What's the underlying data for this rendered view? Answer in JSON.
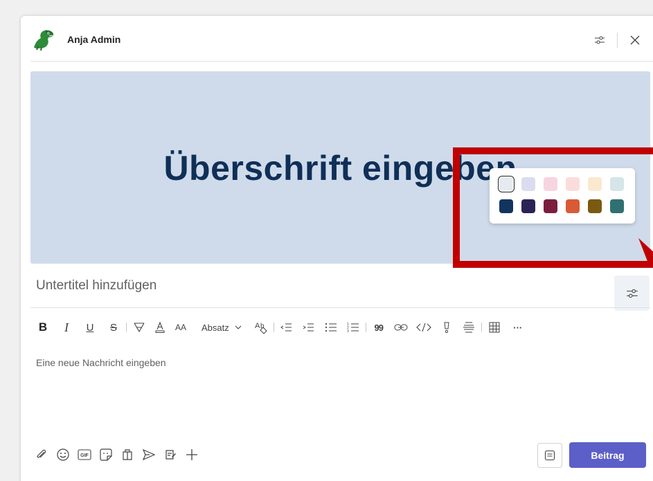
{
  "header": {
    "author": "Anja Admin"
  },
  "banner": {
    "headline": "Überschrift eingeben",
    "background": "#cfdbea",
    "headline_color": "#0f2f57"
  },
  "palette": {
    "light": [
      "#e6ebf2",
      "#dcdcef",
      "#f6d5e0",
      "#fbdcdc",
      "#fbe9cf",
      "#d6e5e8"
    ],
    "dark": [
      "#123560",
      "#2b2356",
      "#7b1d3e",
      "#d95a37",
      "#7a5a11",
      "#2f7170"
    ],
    "selected_index": 0
  },
  "subtitle_placeholder": "Untertitel hinzufügen",
  "toolbar": {
    "bold": "B",
    "italic": "I",
    "underline": "U",
    "strike": "S",
    "font_size": "AA",
    "paragraph": "Absatz",
    "quote": "99",
    "more": "···"
  },
  "compose_placeholder": "Eine neue Nachricht eingeben",
  "bottom": {
    "gif": "GIF",
    "post": "Beitrag"
  },
  "colors": {
    "accent": "#5b5fc7",
    "highlight": "#c00000"
  }
}
